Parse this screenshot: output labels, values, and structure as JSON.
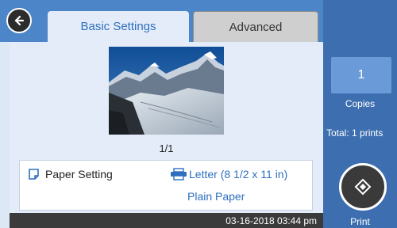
{
  "header": {
    "back_icon": "back-arrow-icon",
    "tabs": [
      {
        "label": "Basic Settings",
        "active": true
      },
      {
        "label": "Advanced",
        "active": false
      }
    ]
  },
  "preview": {
    "page_counter": "1/1",
    "image_subject": "mountain-landscape"
  },
  "paper": {
    "setting_label": "Paper Setting",
    "setting_icon": "paper-setting-icon",
    "size": "Letter (8 1/2 x 11 in)",
    "size_icon": "printer-icon",
    "type": "Plain Paper"
  },
  "status": {
    "datetime": "03-16-2018 03:44 pm"
  },
  "sidebar": {
    "copies_value": "1",
    "copies_label": "Copies",
    "total_label": "Total: 1 prints",
    "print_icon": "start-diamond-icon",
    "print_label": "Print"
  },
  "colors": {
    "header_blue": "#4c86c8",
    "sidebar_blue": "#3d6fb0",
    "accent_blue": "#2f6fc0",
    "panel_bg": "#e3ecf8"
  }
}
